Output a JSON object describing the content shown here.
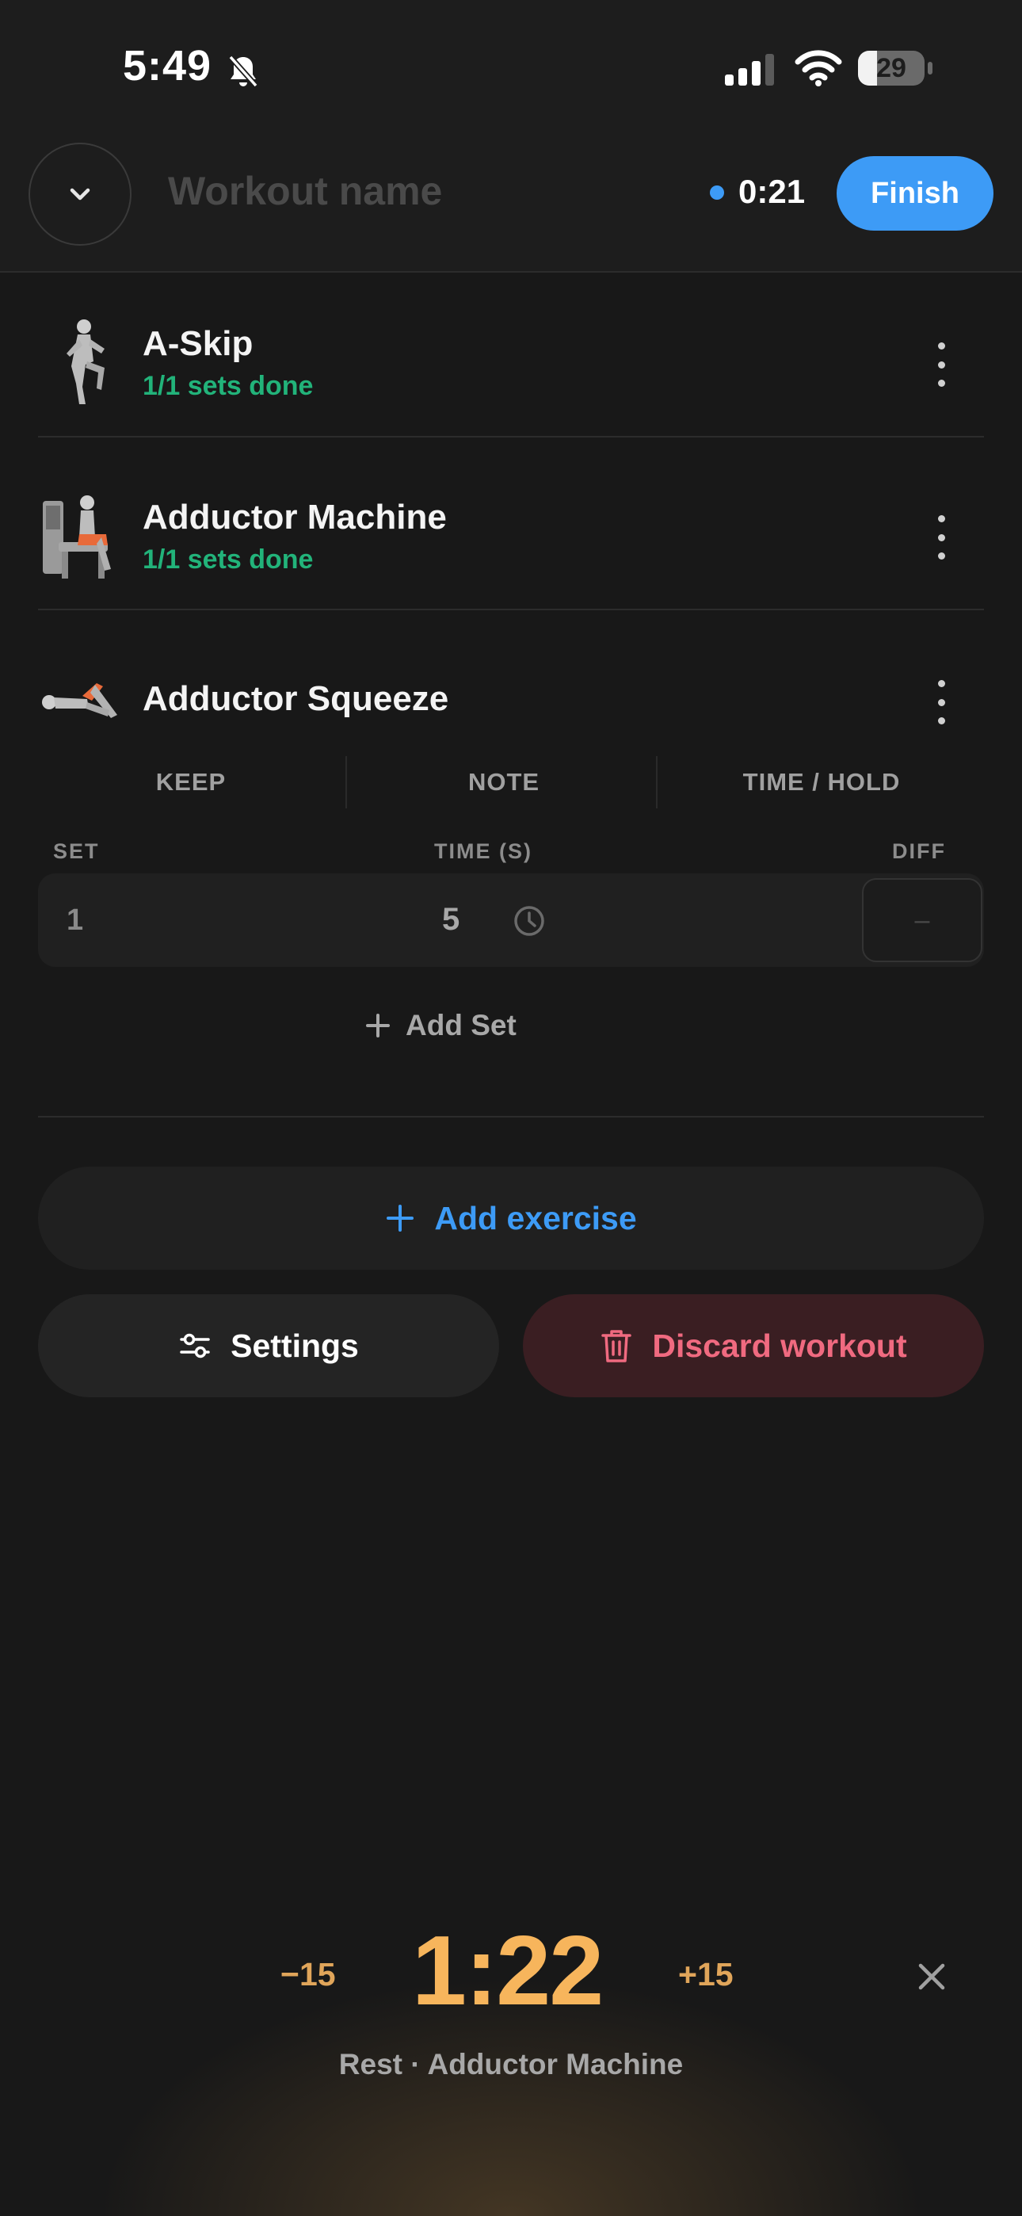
{
  "status_bar": {
    "time": "5:49",
    "battery": "29"
  },
  "header": {
    "collapse_icon": "chevron-down-icon",
    "workout_name_placeholder": "Workout name",
    "elapsed": "0:21",
    "finish_label": "Finish",
    "accent": "#3d9bf6"
  },
  "exercises": [
    {
      "name": "A-Skip",
      "status": "1/1 sets done"
    },
    {
      "name": "Adductor Machine",
      "status": "1/1 sets done"
    },
    {
      "name": "Adductor Squeeze"
    }
  ],
  "active_exercise": {
    "tabs": [
      "KEEP",
      "NOTE",
      "TIME / HOLD"
    ],
    "columns": {
      "set": "SET",
      "time": "TIME (S)",
      "diff": "DIFF"
    },
    "sets": [
      {
        "set": "1",
        "time": "5",
        "diff": "–"
      }
    ],
    "add_set_label": "Add Set"
  },
  "actions": {
    "add_exercise_label": "Add exercise",
    "settings_label": "Settings",
    "discard_label": "Discard workout"
  },
  "rest_timer": {
    "minus_label": "−15",
    "time": "1:22",
    "plus_label": "+15",
    "label": "Rest · Adductor Machine"
  },
  "colors": {
    "done_green": "#22b37a",
    "rest_orange": "#f7b55c",
    "danger": "#f06a80"
  }
}
